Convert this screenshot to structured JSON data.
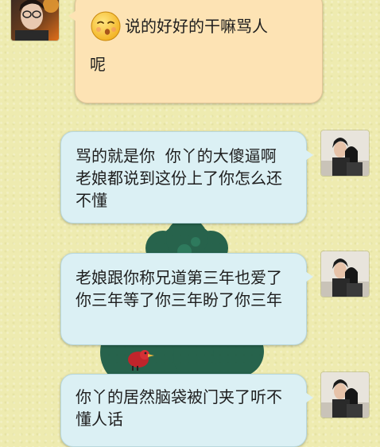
{
  "conversation": {
    "messages": [
      {
        "side": "left",
        "sender": "contact",
        "emoji": "blowing-kiss-emoji",
        "text_line1": "说的好好的干嘛骂人",
        "text_line2": "呢"
      },
      {
        "side": "right",
        "sender": "self",
        "text": "骂的就是你  你丫的大傻逼啊  老娘都说到这份上了你怎么还不懂"
      },
      {
        "side": "right",
        "sender": "self",
        "text": "老娘跟你称兄道第三年也爱了你三年等了你三年盼了你三年"
      },
      {
        "side": "right",
        "sender": "self",
        "text": "你丫的居然脑袋被门夹了听不懂人话"
      }
    ]
  },
  "colors": {
    "background": "#eeebb0",
    "bubble_left": "#fde3b4",
    "bubble_right": "#dbf0f4",
    "wallpaper_deco": "#1c5b45"
  },
  "icons": {
    "emoji": "blowing-kiss-emoji",
    "contact_avatar": "contact-avatar-photo",
    "self_avatar": "self-avatar-photo"
  }
}
